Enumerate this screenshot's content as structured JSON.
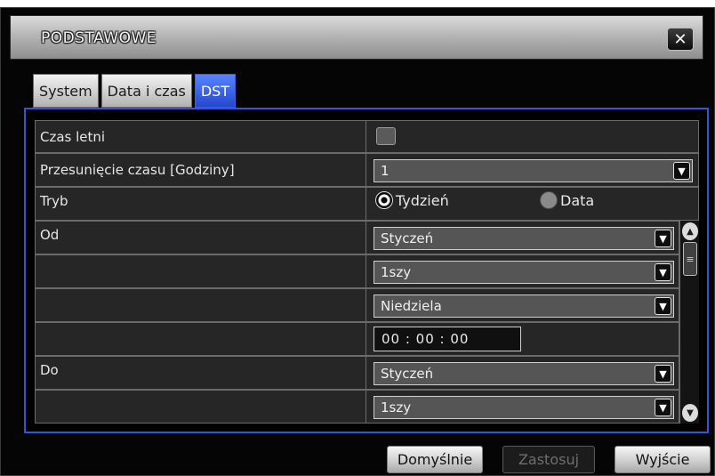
{
  "window": {
    "title": "PODSTAWOWE",
    "close_icon": "close-icon"
  },
  "tabs": [
    {
      "label": "System",
      "active": false
    },
    {
      "label": "Data i czas",
      "active": false
    },
    {
      "label": "DST",
      "active": true
    }
  ],
  "form": {
    "dst": {
      "label": "Czas letni",
      "checked": false
    },
    "offset": {
      "label": "Przesunięcie czasu [Godziny]",
      "value": "1"
    },
    "mode": {
      "label": "Tryb",
      "option_week": "Tydzień",
      "option_date": "Data",
      "selected": "Tydzień"
    },
    "from": {
      "label": "Od",
      "month": "Styczeń",
      "week": "1szy",
      "day": "Niedziela",
      "time": "00 : 00 : 00"
    },
    "to": {
      "label": "Do",
      "month": "Styczeń",
      "week": "1szy"
    }
  },
  "buttons": {
    "defaults": "Domyślnie",
    "apply": "Zastosuj",
    "exit": "Wyjście"
  },
  "colors": {
    "accent": "#2f55d9",
    "active_tab": "#3a66ff",
    "panel_bg": "#262626"
  }
}
